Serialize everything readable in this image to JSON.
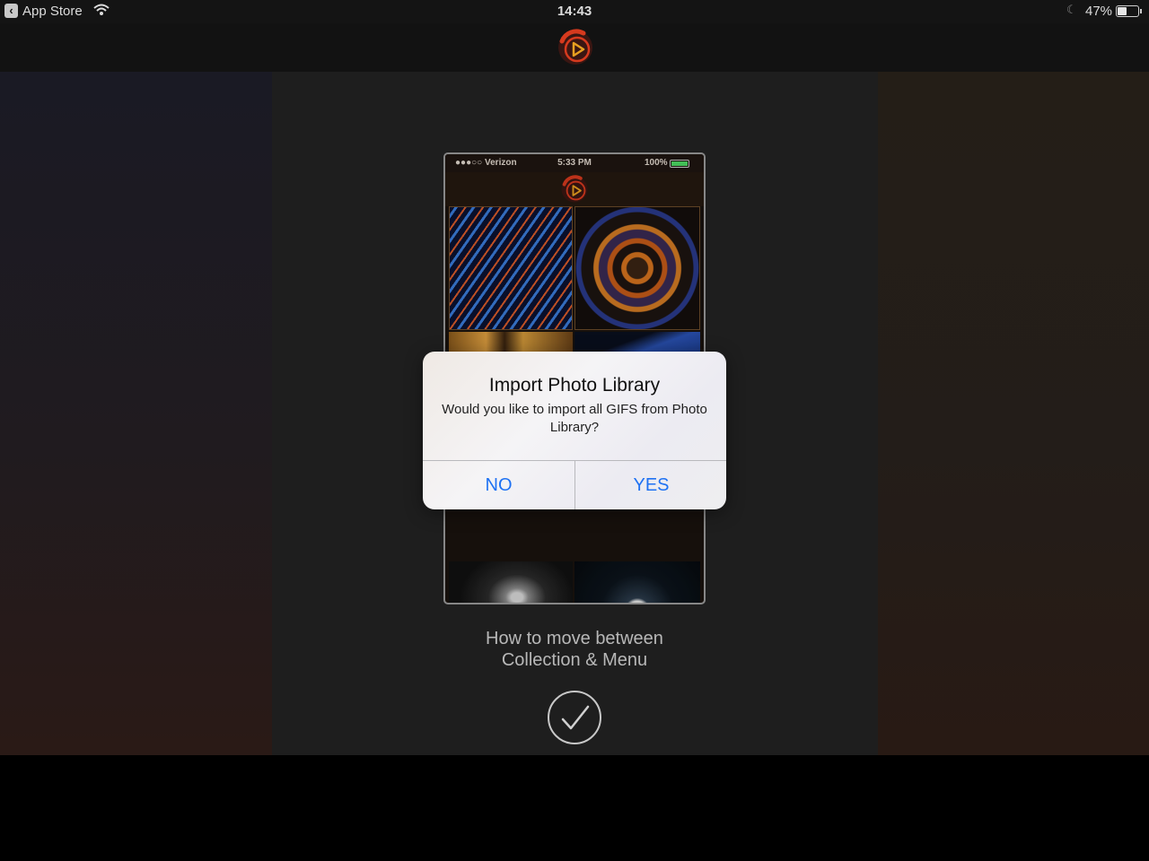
{
  "status_bar": {
    "back_app": "App Store",
    "time": "14:43",
    "battery": "47%",
    "battery_level": 0.47
  },
  "phone_preview": {
    "signal": "●●●○○",
    "carrier": "Verizon",
    "time": "5:33 PM",
    "battery": "100%"
  },
  "alert": {
    "title": "Import Photo Library",
    "message": "Would you like to import all GIFS from Photo Library?",
    "no_label": "NO",
    "yes_label": "YES"
  },
  "onboarding": {
    "caption_line1": "How to move between",
    "caption_line2": "Collection & Menu"
  },
  "colors": {
    "accent_button": "#1f72f3",
    "logo_red": "#d63a1e",
    "logo_orange": "#e8a020"
  }
}
